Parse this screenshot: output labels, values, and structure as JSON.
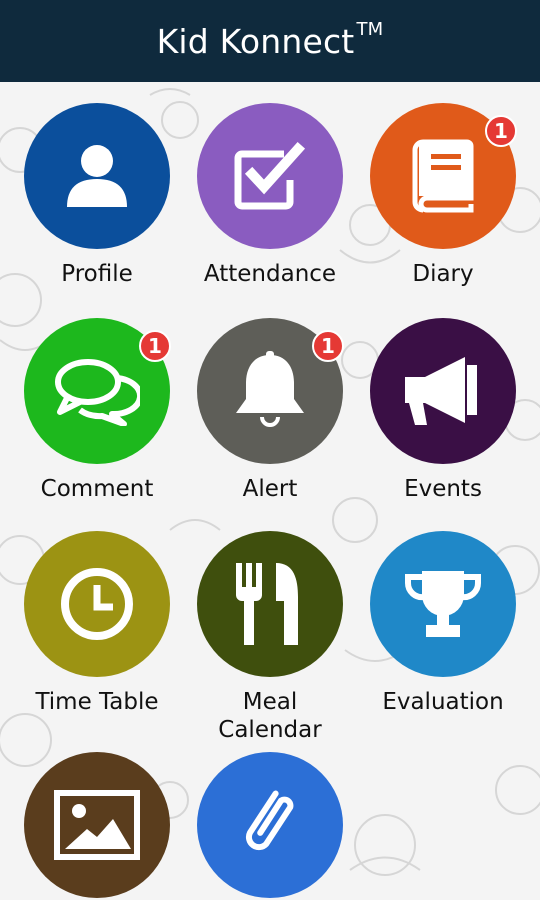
{
  "app": {
    "title": "Kid Konnect",
    "trademark": "TM"
  },
  "tiles": [
    {
      "key": "profile",
      "label": "Profile",
      "color": "#0b4f9c",
      "badge": null,
      "icon": "person-icon"
    },
    {
      "key": "attendance",
      "label": "Attendance",
      "color": "#8a5cc0",
      "badge": null,
      "icon": "checkbox-icon"
    },
    {
      "key": "diary",
      "label": "Diary",
      "color": "#e05a1a",
      "badge": "1",
      "icon": "book-icon"
    },
    {
      "key": "comment",
      "label": "Comment",
      "color": "#1db81d",
      "badge": "1",
      "icon": "chat-bubbles-icon"
    },
    {
      "key": "alert",
      "label": "Alert",
      "color": "#5e5e58",
      "badge": "1",
      "icon": "bell-icon"
    },
    {
      "key": "events",
      "label": "Events",
      "color": "#3a0f45",
      "badge": null,
      "icon": "megaphone-icon"
    },
    {
      "key": "timetable",
      "label": "Time Table",
      "color": "#9c9313",
      "badge": null,
      "icon": "clock-icon"
    },
    {
      "key": "meal",
      "label_line1": "Meal",
      "label_line2": "Calendar",
      "color": "#3f4f0d",
      "badge": null,
      "icon": "fork-knife-icon"
    },
    {
      "key": "evaluation",
      "label": "Evaluation",
      "color": "#1f88c8",
      "badge": null,
      "icon": "trophy-icon"
    },
    {
      "key": "gallery",
      "color": "#5a3d1d",
      "badge": null,
      "icon": "image-icon"
    },
    {
      "key": "attachments",
      "color": "#2c6fd6",
      "badge": null,
      "icon": "paperclip-icon"
    }
  ]
}
